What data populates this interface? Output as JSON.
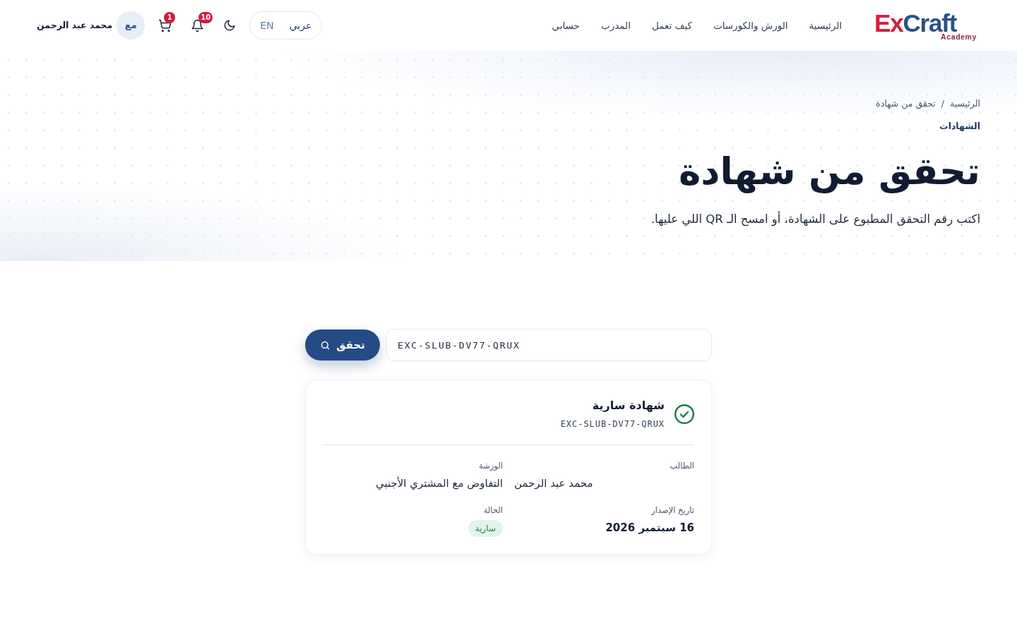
{
  "header": {
    "logo": {
      "lead": "Ex",
      "rest": "Craft",
      "tagline": "Academy"
    },
    "nav": [
      "الرئيسية",
      "الورش والكورسات",
      "كيف تعمل",
      "المدرب",
      "حسابي"
    ],
    "language_switch": [
      {
        "label": "عربي",
        "selected": true
      },
      {
        "label": "EN",
        "selected": false
      }
    ],
    "notifications": {
      "count": "10"
    },
    "cart": {
      "count": "1"
    },
    "user": {
      "initials": "مع",
      "name": "محمد عبد الرحمن"
    }
  },
  "breadcrumb": {
    "items": [
      "الرئيسية",
      "تحقق من شهادة"
    ],
    "separator": "/"
  },
  "eyebrow": "الشهادات",
  "title": "تحقق من شهادة",
  "subtitle": "اكتب رقم التحقق المطبوع على الشهادة، أو امسح الـ QR اللي عليها.",
  "verify_form": {
    "value": "EXC-SLUB-DV77-QRUX",
    "button": "تحقق"
  },
  "result": {
    "valid": true,
    "title": "شهادة سارية",
    "code": "EXC-SLUB-DV77-QRUX",
    "fields": [
      {
        "label": "الطالب",
        "value": "محمد عبد الرحمن",
        "kind": "name"
      },
      {
        "label": "الورشة",
        "value": "التفاوض مع المشتري الأجنبي",
        "kind": "text"
      },
      {
        "label": "تاريخ الإصدار",
        "value": "16 سبتمبر 2026",
        "kind": "date"
      },
      {
        "label": "الحالة",
        "value": "سارية",
        "kind": "badge"
      }
    ]
  }
}
